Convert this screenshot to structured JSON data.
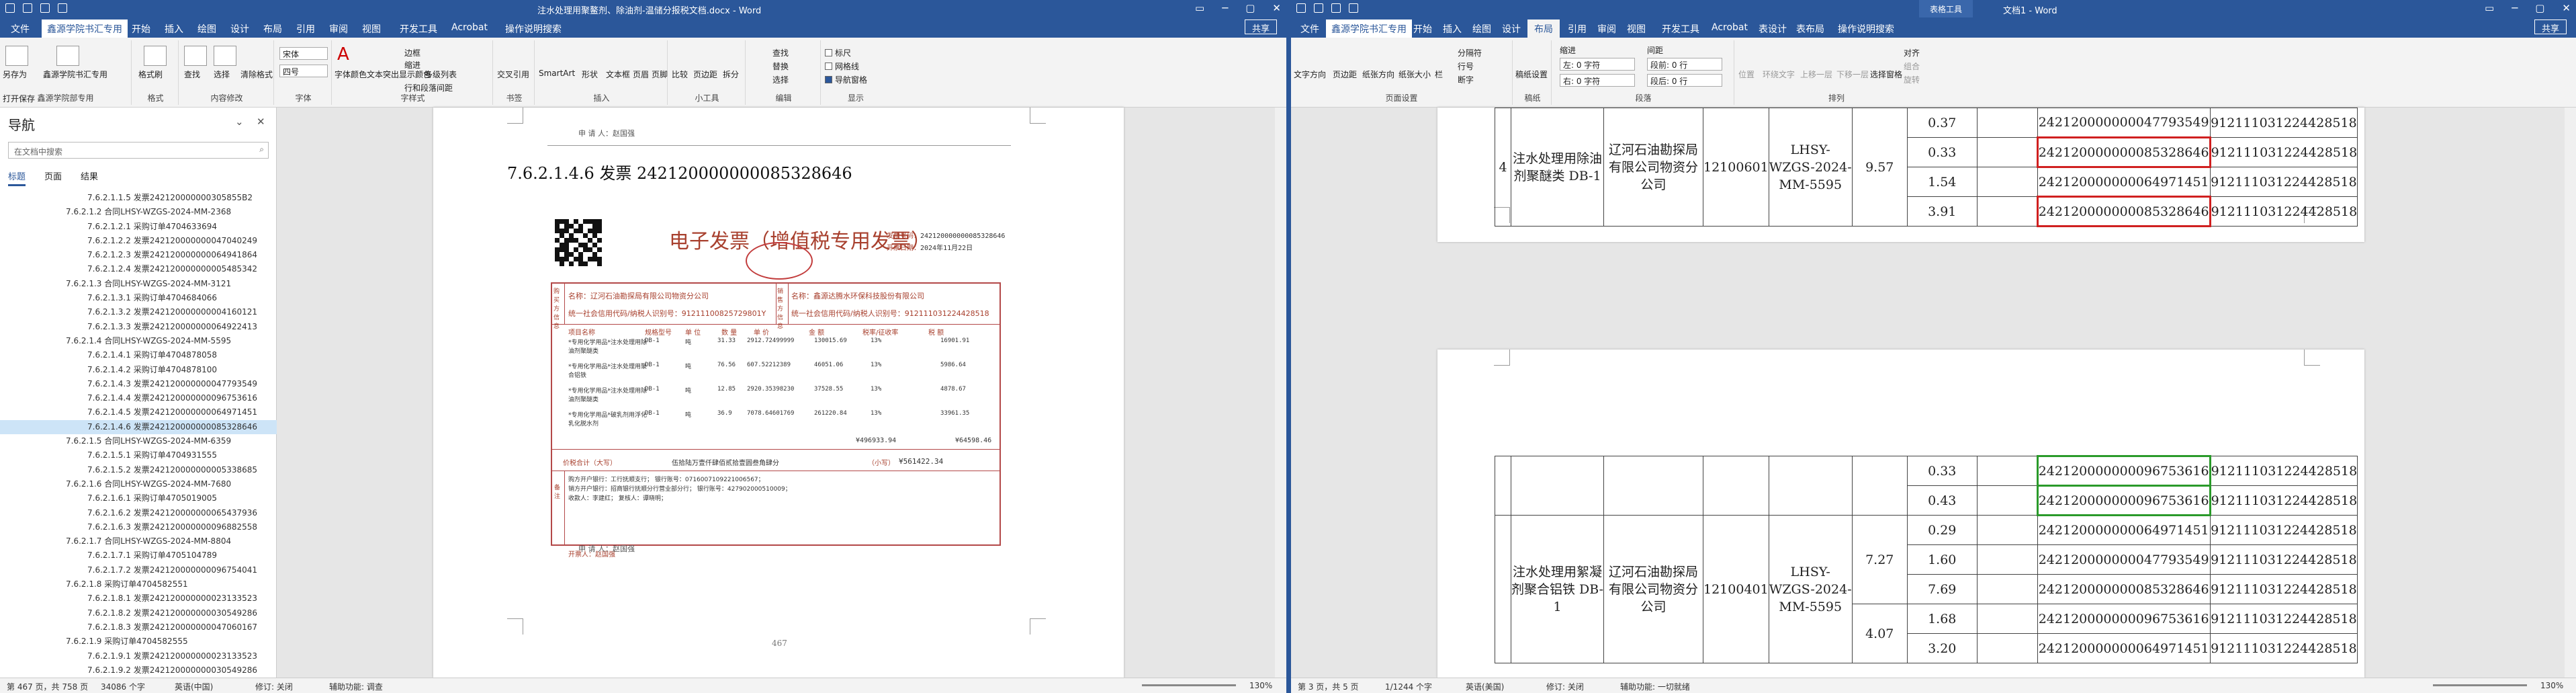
{
  "left": {
    "title": "注水处理用聚鳌剂、除油剂-温储分报税文档.docx - Word",
    "menu_tabs": [
      "文件",
      "鑫源学院书汇专用",
      "开始",
      "插入",
      "绘图",
      "设计",
      "布局",
      "引用",
      "审阅",
      "视图",
      "开发工具",
      "Acrobat",
      "操作说明搜索"
    ],
    "share": "共享",
    "ribbon": {
      "g1": {
        "b1": "另存为",
        "b2": "打开保存",
        "label": "鑫源学院书汇专用",
        "b3": "鑫源学院书汇专用",
        "b4": "鑫源学院部专用"
      },
      "g2": {
        "b1": "格式刷",
        "label": "格式"
      },
      "g3": {
        "b1": "查找",
        "b2": "选择",
        "b3": "清除格式",
        "label": "内容修改"
      },
      "font": {
        "name": "宋体",
        "size": "四号",
        "label": "字体"
      },
      "style": {
        "b1": "字体颜色",
        "b2": "文本突出显示颜色",
        "b3": "多级列表",
        "b4": "边框",
        "b5": "缩进",
        "b6": "行和段落间距",
        "label": "字样式"
      },
      "g4": {
        "b1": "交叉引用",
        "label": "书签"
      },
      "insert": {
        "b1": "SmartArt",
        "b2": "形状",
        "b3": "文本框",
        "b4": "页眉",
        "b5": "页脚",
        "label": "插入"
      },
      "tools": {
        "b1": "比较",
        "b2": "页边距",
        "b3": "拆分",
        "label": "小工具"
      },
      "edit": {
        "b1": "查找",
        "b2": "替换",
        "b3": "选择",
        "label": "编辑"
      },
      "show": {
        "c1": "标尺",
        "c2": "网格线",
        "c3": "导航窗格",
        "label": "显示"
      }
    },
    "nav": {
      "title": "导航",
      "search_placeholder": "在文档中搜索",
      "tabs": [
        "标题",
        "页面",
        "结果"
      ],
      "items": [
        "7.6.2.1.1.5 发票242120000000305855B2",
        "7.6.2.1.2 合同LHSY-WZGS-2024-MM-2368",
        "7.6.2.1.2.1 采购订单4704633694",
        "7.6.2.1.2.2 发票242120000000047040249",
        "7.6.2.1.2.3 发票242120000000064941864",
        "7.6.2.1.2.4 发票242120000000005485342",
        "7.6.2.1.3 合同LHSY-WZGS-2024-MM-3121",
        "7.6.2.1.3.1 采购订单4704684066",
        "7.6.2.1.3.2 发票242120000000004160121",
        "7.6.2.1.3.3 发票242120000000064922413",
        "7.6.2.1.4 合同LHSY-WZGS-2024-MM-5595",
        "7.6.2.1.4.1 采购订单4704878058",
        "7.6.2.1.4.2 采购订单4704878100",
        "7.6.2.1.4.3 发票242120000000047793549",
        "7.6.2.1.4.4 发票242120000000096753616",
        "7.6.2.1.4.5 发票242120000000064971451",
        "7.6.2.1.4.6 发票242120000000085328646",
        "7.6.2.1.5 合同LHSY-WZGS-2024-MM-6359",
        "7.6.2.1.5.1 采购订单4704931555",
        "7.6.2.1.5.2 发票242120000000005338685",
        "7.6.2.1.6 合同LHSY-WZGS-2024-MM-7680",
        "7.6.2.1.6.1 采购订单4705019005",
        "7.6.2.1.6.2 发票242120000000065437936",
        "7.6.2.1.6.3 发票242120000000096882558",
        "7.6.2.1.7 合同LHSY-WZGS-2024-MM-8804",
        "7.6.2.1.7.1 采购订单4705104789",
        "7.6.2.1.7.2 发票242120000000096754041",
        "7.6.2.1.8 采购订单4704582551",
        "7.6.2.1.8.1 发票242120000000023133523",
        "7.6.2.1.8.2 发票242120000000030549286",
        "7.6.2.1.8.3 发票242120000000047060167",
        "7.6.2.1.9 采购订单4704582555",
        "7.6.2.1.9.1 发票242120000000023133523",
        "7.6.2.1.9.2 发票242120000000030549286"
      ],
      "selected": 16
    },
    "doc": {
      "top_note": "申 请 人：赵国强",
      "heading": "7.6.2.1.4.6 发票 242120000000085328646",
      "invoice": {
        "title": "电子发票（增值税专用发票）",
        "no_label": "发票号码：",
        "no_value": "242120000000085328646",
        "date_label": "开票日期：",
        "date_value": "2024年11月22日",
        "buyer_name": "名称：辽河石油勘探局有限公司物资分公司",
        "buyer_id": "统一社会信用代码/纳税人识别号：91211100825729801Y",
        "seller_name": "名称：鑫源达腾水环保科技股份有限公司",
        "seller_id": "统一社会信用代码/纳税人识别号：912111031224428518",
        "cols": [
          "项目名称",
          "规格型号",
          "单 位",
          "数 量",
          "单 价",
          "金 额",
          "税率/征收率",
          "税 额"
        ],
        "rows": [
          [
            "*专用化学用品*注水处理用除油剂聚醚类",
            "DB-1",
            "吨",
            "31.33",
            "2912.72499999",
            "130015.69",
            "13%",
            "16901.91"
          ],
          [
            "*专用化学用品*注水处理用聚合铝铁",
            "DB-1",
            "吨",
            "76.56",
            "607.52212389",
            "46051.06",
            "13%",
            "5986.64"
          ],
          [
            "*专用化学用品*注水处理用除油剂聚醚类",
            "DB-1",
            "吨",
            "12.85",
            "2920.35398230",
            "37528.55",
            "13%",
            "4878.67"
          ],
          [
            "*专用化学用品*破乳剂用浮化乳化脱水剂",
            "DB-1",
            "吨",
            "36.9",
            "7078.64601769",
            "261220.84",
            "13%",
            "33961.35"
          ]
        ],
        "sum_amount": "¥496933.94",
        "sum_tax": "¥64598.46",
        "total_label": "价税合计（大写）",
        "total_words": "伍拾陆万壹仟肆佰贰拾壹圆叁角肆分",
        "total_small_label": "（小写）",
        "total_num": "¥561422.34",
        "remark1": "购方开户银行：工行抚顺支行；    银行账号：0716007109221006567；",
        "remark2": "销方开户银行：招商银行抚顺分行营业部分行；    银行账号：427902000510009；",
        "remark3": "收款人：李建红；    复核人：谭晓明；",
        "side_buyer": "购买方信息",
        "side_seller": "销售方信息",
        "side_remark": "备注",
        "issuer": "开票人：赵国强"
      },
      "bottom_note": "申 请 人：赵国强",
      "page_no": "467"
    },
    "status": {
      "page": "第 467 页，共 758 页",
      "words": "34086 个字",
      "lang": "英语(中国)",
      "track": "修订: 关闭",
      "access": "辅助功能: 调查",
      "zoom": "130%"
    }
  },
  "right": {
    "title": "文档1 - Word",
    "context_tab": "表格工具",
    "menu_tabs": [
      "文件",
      "鑫源学院书汇专用",
      "开始",
      "插入",
      "绘图",
      "设计",
      "布局",
      "引用",
      "审阅",
      "视图",
      "开发工具",
      "Acrobat",
      "表设计",
      "表布局",
      "操作说明搜索"
    ],
    "share": "共享",
    "ribbon": {
      "setup": {
        "b1": "文字方向",
        "b2": "页边距",
        "b3": "纸张方向",
        "b4": "纸张大小",
        "b5": "栏",
        "b6": "分隔符",
        "b7": "行号",
        "b8": "断字",
        "label": "页面设置"
      },
      "g2": {
        "b1": "稿纸设置",
        "label": "稿纸"
      },
      "para": {
        "indent": "缩进",
        "left": "左: 0 字符",
        "right": "右: 0 字符",
        "spacing": "间距",
        "before": "段前: 0 行",
        "after": "段后: 0 行",
        "label": "段落"
      },
      "arrange": {
        "b1": "位置",
        "b2": "环绕文字",
        "b3": "上移一层",
        "b4": "下移一层",
        "b5": "选择窗格",
        "b6": "对齐",
        "b7": "组合",
        "b8": "旋转",
        "label": "排列"
      }
    },
    "t1": {
      "num": "4",
      "name": "注水处理用除油剂聚醚类 DB-1",
      "company": "辽河石油勘探局有限公司物资分公司",
      "code": "12100601",
      "contract": "LHSY-WZGS-2024-MM-5595",
      "qty": "9.57",
      "rows": [
        {
          "v": "0.37",
          "inv": "242120000000047793549",
          "tax": "912111031224428518"
        },
        {
          "v": "0.33",
          "inv": "242120000000085328646",
          "tax": "912111031224428518"
        },
        {
          "v": "1.54",
          "inv": "242120000000064971451",
          "tax": "912111031224428518"
        },
        {
          "v": "3.91",
          "inv": "242120000000085328646",
          "tax": "912111031224428518"
        }
      ]
    },
    "t2": {
      "name": "注水处理用絮凝剂聚合铝铁 DB-1",
      "company": "辽河石油勘探局有限公司物资分公司",
      "code": "12100401",
      "contract": "LHSY-WZGS-2024-MM-5595",
      "qty1": "7.27",
      "qty2": "4.07",
      "rows": [
        {
          "v": "0.33",
          "inv": "242120000000096753616",
          "tax": "912111031224428518"
        },
        {
          "v": "0.43",
          "inv": "242120000000096753616",
          "tax": "912111031224428518"
        },
        {
          "v": "0.29",
          "inv": "242120000000064971451",
          "tax": "912111031224428518"
        },
        {
          "v": "1.60",
          "inv": "242120000000047793549",
          "tax": "912111031224428518"
        },
        {
          "v": "7.69",
          "inv": "242120000000085328646",
          "tax": "912111031224428518"
        },
        {
          "v": "1.68",
          "inv": "242120000000096753616",
          "tax": "912111031224428518"
        },
        {
          "v": "3.20",
          "inv": "242120000000064971451",
          "tax": "912111031224428518"
        }
      ]
    },
    "status": {
      "page": "第 3 页，共 5 页",
      "words": "1/1244 个字",
      "lang": "英语(美国)",
      "track": "修订: 关闭",
      "access": "辅助功能: 一切就绪",
      "zoom": "130%"
    }
  }
}
